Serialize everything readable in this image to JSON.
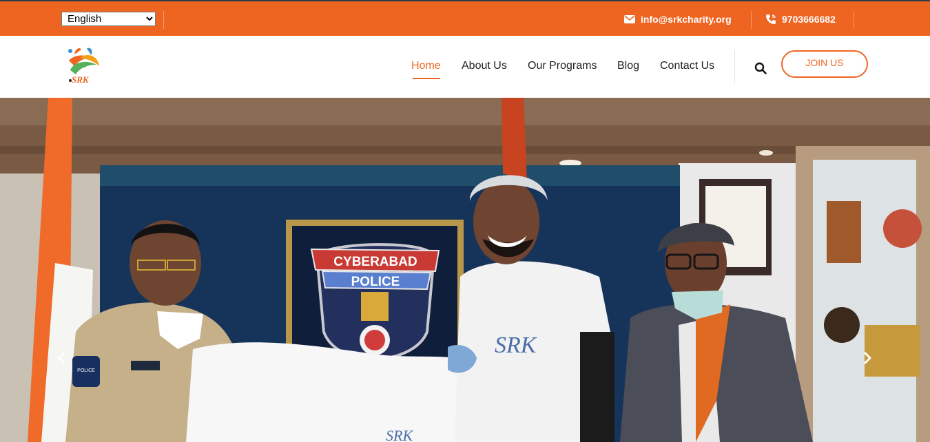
{
  "topbar": {
    "language": {
      "selected": "English"
    },
    "email": "info@srkcharity.org",
    "phone": "9703666682"
  },
  "header": {
    "logo_text": "SRK",
    "nav": {
      "home": "Home",
      "about": "About Us",
      "programs": "Our Programs",
      "blog": "Blog",
      "contact": "Contact Us"
    },
    "join_label": "JOIN US"
  },
  "hero": {
    "emblem_top": "CYBERABAD",
    "emblem_bottom": "POLICE",
    "shirt_text": "SRK",
    "badge_left": "POLICE"
  },
  "colors": {
    "accent": "#ee6521",
    "topbar_border": "#2d3a4a",
    "text": "#222222"
  },
  "icons": [
    "envelope-icon",
    "phone-icon",
    "search-icon",
    "chevron-left-icon",
    "chevron-right-icon"
  ]
}
